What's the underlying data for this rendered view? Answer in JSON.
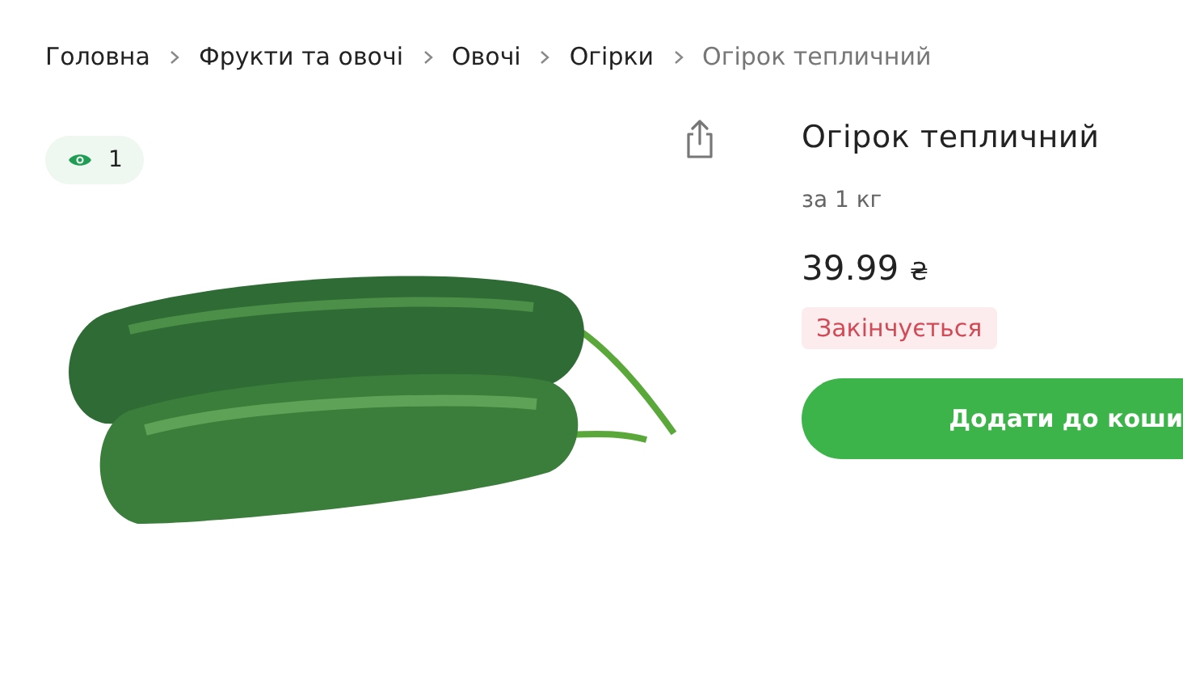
{
  "breadcrumbs": [
    {
      "label": "Головна",
      "current": false
    },
    {
      "label": "Фрукти та овочі",
      "current": false
    },
    {
      "label": "Овочі",
      "current": false
    },
    {
      "label": "Огірки",
      "current": false
    },
    {
      "label": "Огірок тепличний",
      "current": true
    }
  ],
  "views": {
    "count": "1"
  },
  "product": {
    "title": "Огірок тепличний",
    "unit": "за 1 кг",
    "price": "39.99",
    "currency": "₴",
    "stock_badge": "Закінчується",
    "add_button": "Додати до коши"
  }
}
